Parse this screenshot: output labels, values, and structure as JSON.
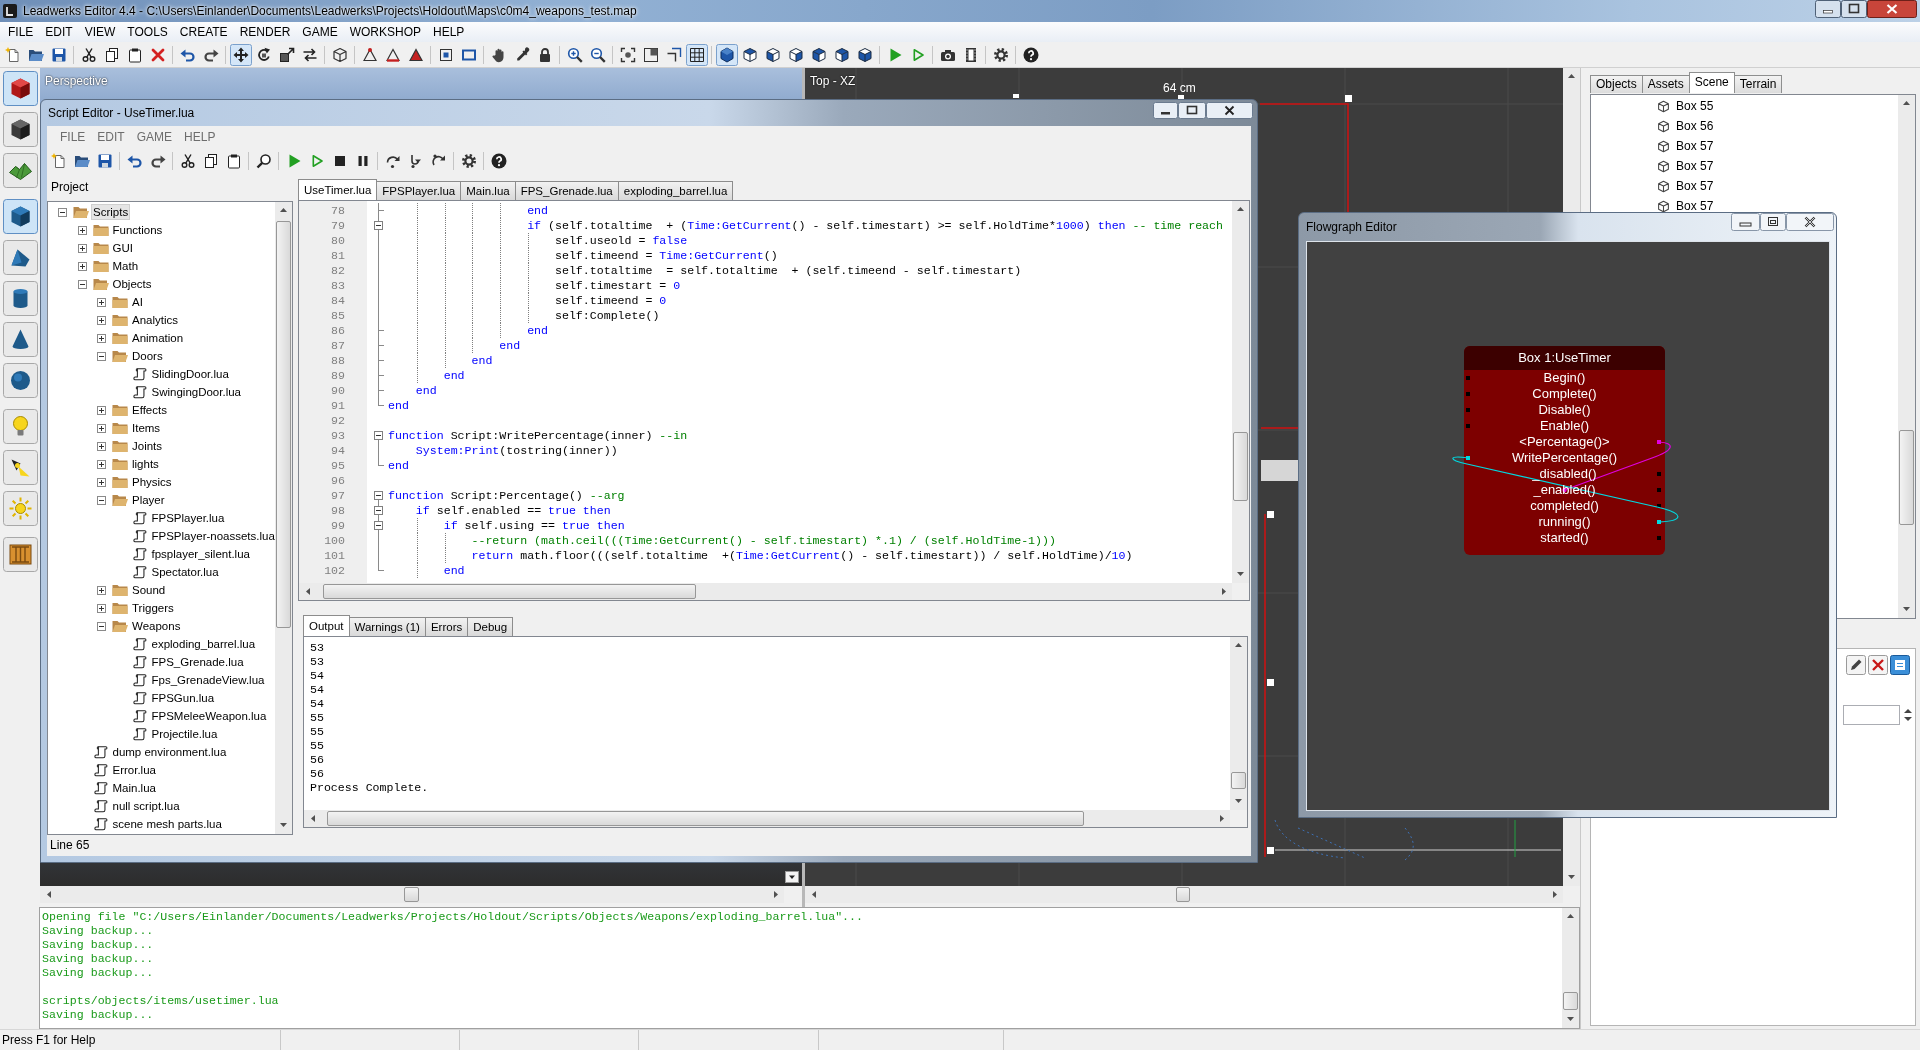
{
  "window": {
    "title": "Leadwerks Editor 4.4 - C:\\Users\\Einlander\\Documents\\Leadwerks\\Projects\\Holdout\\Maps\\c0m4_weapons_test.map"
  },
  "menu": [
    "FILE",
    "EDIT",
    "VIEW",
    "TOOLS",
    "CREATE",
    "RENDER",
    "GAME",
    "WORKSHOP",
    "HELP"
  ],
  "toolbar": [
    [
      {
        "pressed": false
      },
      {
        "pressed": false
      },
      {
        "pressed": false
      }
    ],
    [
      {
        "pressed": false
      },
      {
        "pressed": false
      },
      {
        "pressed": false
      },
      {
        "pressed": false
      }
    ],
    [
      {
        "pressed": false
      },
      {
        "pressed": false
      }
    ],
    [
      {
        "pressed": true
      },
      {
        "pressed": false
      },
      {
        "pressed": false
      },
      {
        "pressed": false
      }
    ],
    [
      {
        "pressed": false
      }
    ],
    [
      {
        "pressed": false
      },
      {
        "pressed": false
      },
      {
        "pressed": false
      }
    ],
    [
      {
        "pressed": false
      },
      {
        "pressed": false
      }
    ],
    [
      {
        "pressed": false
      },
      {
        "pressed": false
      },
      {
        "pressed": false
      }
    ],
    [
      {
        "pressed": false
      },
      {
        "pressed": false
      }
    ],
    [
      {
        "pressed": false
      },
      {
        "pressed": false
      },
      {
        "pressed": false
      },
      {
        "pressed": true
      }
    ],
    [
      {
        "pressed": true
      },
      {
        "pressed": false
      },
      {
        "pressed": false
      },
      {
        "pressed": false
      },
      {
        "pressed": false
      },
      {
        "pressed": false
      },
      {
        "pressed": false
      }
    ],
    [
      {
        "pressed": false
      },
      {
        "pressed": false
      }
    ],
    [
      {
        "pressed": false
      },
      {
        "pressed": false
      }
    ],
    [
      {
        "pressed": false
      }
    ],
    [
      {
        "pressed": false
      }
    ]
  ],
  "tools": [
    [
      {
        "pressed": true
      },
      {
        "pressed": false
      },
      {
        "pressed": false
      }
    ],
    [
      {
        "pressed": true
      },
      {
        "pressed": false
      },
      {
        "pressed": false
      },
      {
        "pressed": false
      },
      {
        "pressed": false
      }
    ],
    [
      {
        "pressed": false
      },
      {
        "pressed": false
      },
      {
        "pressed": false
      }
    ],
    [
      {
        "pressed": false
      }
    ]
  ],
  "viewports": [
    {
      "kind": "render",
      "label": "Perspective"
    },
    {
      "kind": "grid",
      "label": "Top - XZ",
      "scale": "64 cm"
    }
  ],
  "script_editor": {
    "title": "Script Editor - UseTimer.lua",
    "menu": [
      "FILE",
      "EDIT",
      "GAME",
      "HELP"
    ],
    "project": {
      "label": "Project",
      "tree": [
        {
          "label": "Scripts",
          "kind": "folder",
          "expanded": true,
          "selected": true,
          "children": [
            {
              "label": "Functions",
              "kind": "folder",
              "expanded": false,
              "selected": false
            },
            {
              "label": "GUI",
              "kind": "folder",
              "expanded": false,
              "selected": false
            },
            {
              "label": "Math",
              "kind": "folder",
              "expanded": false,
              "selected": false
            },
            {
              "label": "Objects",
              "kind": "folder",
              "expanded": true,
              "selected": false,
              "children": [
                {
                  "label": "AI",
                  "kind": "folder",
                  "expanded": false,
                  "selected": false
                },
                {
                  "label": "Analytics",
                  "kind": "folder",
                  "expanded": false,
                  "selected": false
                },
                {
                  "label": "Animation",
                  "kind": "folder",
                  "expanded": false,
                  "selected": false
                },
                {
                  "label": "Doors",
                  "kind": "folder",
                  "expanded": true,
                  "selected": false,
                  "children": [
                    {
                      "label": "SlidingDoor.lua",
                      "kind": "file",
                      "selected": false
                    },
                    {
                      "label": "SwingingDoor.lua",
                      "kind": "file",
                      "selected": false
                    }
                  ]
                },
                {
                  "label": "Effects",
                  "kind": "folder",
                  "expanded": false,
                  "selected": false
                },
                {
                  "label": "Items",
                  "kind": "folder",
                  "expanded": false,
                  "selected": false
                },
                {
                  "label": "Joints",
                  "kind": "folder",
                  "expanded": false,
                  "selected": false
                },
                {
                  "label": "lights",
                  "kind": "folder",
                  "expanded": false,
                  "selected": false
                },
                {
                  "label": "Physics",
                  "kind": "folder",
                  "expanded": false,
                  "selected": false
                },
                {
                  "label": "Player",
                  "kind": "folder",
                  "expanded": true,
                  "selected": false,
                  "children": [
                    {
                      "label": "FPSPlayer.lua",
                      "kind": "file",
                      "selected": false
                    },
                    {
                      "label": "FPSPlayer-noassets.lua",
                      "kind": "file",
                      "selected": false
                    },
                    {
                      "label": "fpsplayer_silent.lua",
                      "kind": "file",
                      "selected": false
                    },
                    {
                      "label": "Spectator.lua",
                      "kind": "file",
                      "selected": false
                    }
                  ]
                },
                {
                  "label": "Sound",
                  "kind": "folder",
                  "expanded": false,
                  "selected": false
                },
                {
                  "label": "Triggers",
                  "kind": "folder",
                  "expanded": false,
                  "selected": false
                },
                {
                  "label": "Weapons",
                  "kind": "folder",
                  "expanded": true,
                  "selected": false,
                  "children": [
                    {
                      "label": "exploding_barrel.lua",
                      "kind": "file",
                      "selected": false
                    },
                    {
                      "label": "FPS_Grenade.lua",
                      "kind": "file",
                      "selected": false
                    },
                    {
                      "label": "Fps_GrenadeView.lua",
                      "kind": "file",
                      "selected": false
                    },
                    {
                      "label": "FPSGun.lua",
                      "kind": "file",
                      "selected": false
                    },
                    {
                      "label": "FPSMeleeWeapon.lua",
                      "kind": "file",
                      "selected": false
                    },
                    {
                      "label": "Projectile.lua",
                      "kind": "file",
                      "selected": false
                    }
                  ]
                }
              ]
            },
            {
              "label": "dump environment.lua",
              "kind": "file",
              "selected": false
            },
            {
              "label": "Error.lua",
              "kind": "file",
              "selected": false
            },
            {
              "label": "Main.lua",
              "kind": "file",
              "selected": false
            },
            {
              "label": "null script.lua",
              "kind": "file",
              "selected": false
            },
            {
              "label": "scene mesh parts.lua",
              "kind": "file",
              "selected": false
            }
          ]
        }
      ]
    },
    "tabs": [
      {
        "label": "UseTimer.lua",
        "selected": true
      },
      {
        "label": "FPSPlayer.lua",
        "selected": false
      },
      {
        "label": "Main.lua",
        "selected": false
      },
      {
        "label": "FPS_Grenade.lua",
        "selected": false
      },
      {
        "label": "exploding_barrel.lua",
        "selected": false
      }
    ],
    "code": [
      {
        "number": "78",
        "kind": "end",
        "spans": [
          {
            "kind": "keyword",
            "text": "                    end"
          }
        ]
      },
      {
        "number": "79",
        "kind": "start",
        "expanded": true,
        "spans": [
          {
            "kind": "keyword",
            "text": "                    if"
          },
          {
            "kind": "plain",
            "text": " (self.totaltime  + ("
          },
          {
            "kind": "keyword",
            "text": "Time:GetCurrent"
          },
          {
            "kind": "plain",
            "text": "() - self.timestart) >= self.HoldTime*"
          },
          {
            "kind": "keyword",
            "text": "1000"
          },
          {
            "kind": "plain",
            "text": ") "
          },
          {
            "kind": "keyword",
            "text": "then"
          },
          {
            "kind": "comment",
            "text": " -- time reach"
          }
        ]
      },
      {
        "number": "80",
        "kind": "body",
        "spans": [
          {
            "kind": "plain",
            "text": "                        self.useold = "
          },
          {
            "kind": "keyword",
            "text": "false"
          }
        ]
      },
      {
        "number": "81",
        "kind": "body",
        "spans": [
          {
            "kind": "plain",
            "text": "                        self.timeend = "
          },
          {
            "kind": "keyword",
            "text": "Time:GetCurrent"
          },
          {
            "kind": "plain",
            "text": "()"
          }
        ]
      },
      {
        "number": "82",
        "kind": "body",
        "spans": [
          {
            "kind": "plain",
            "text": "                        self.totaltime  = self.totaltime  + (self.timeend - self.timestart)"
          }
        ]
      },
      {
        "number": "83",
        "kind": "body",
        "spans": [
          {
            "kind": "plain",
            "text": "                        self.timestart = "
          },
          {
            "kind": "keyword",
            "text": "0"
          }
        ]
      },
      {
        "number": "84",
        "kind": "body",
        "spans": [
          {
            "kind": "plain",
            "text": "                        self.timeend = "
          },
          {
            "kind": "keyword",
            "text": "0"
          }
        ]
      },
      {
        "number": "85",
        "kind": "body",
        "spans": [
          {
            "kind": "plain",
            "text": "                        self:Complete()"
          }
        ]
      },
      {
        "number": "86",
        "kind": "end",
        "spans": [
          {
            "kind": "keyword",
            "text": "                    end"
          }
        ]
      },
      {
        "number": "87",
        "kind": "end",
        "spans": [
          {
            "kind": "keyword",
            "text": "                end"
          }
        ]
      },
      {
        "number": "88",
        "kind": "end",
        "spans": [
          {
            "kind": "keyword",
            "text": "            end"
          }
        ]
      },
      {
        "number": "89",
        "kind": "end",
        "spans": [
          {
            "kind": "keyword",
            "text": "        end"
          }
        ]
      },
      {
        "number": "90",
        "kind": "end",
        "spans": [
          {
            "kind": "keyword",
            "text": "    end"
          }
        ]
      },
      {
        "number": "91",
        "kind": "end",
        "spans": [
          {
            "kind": "keyword",
            "text": "end"
          }
        ]
      },
      {
        "number": "92",
        "kind": "none"
      },
      {
        "number": "93",
        "kind": "start",
        "expanded": true,
        "spans": [
          {
            "kind": "keyword",
            "text": "function"
          },
          {
            "kind": "plain",
            "text": " Script:WritePercentage(inner) "
          },
          {
            "kind": "comment",
            "text": "--in"
          }
        ]
      },
      {
        "number": "94",
        "kind": "body",
        "spans": [
          {
            "kind": "keyword",
            "text": "    System:Print"
          },
          {
            "kind": "plain",
            "text": "(tostring(inner))"
          }
        ]
      },
      {
        "number": "95",
        "kind": "end",
        "spans": [
          {
            "kind": "keyword",
            "text": "end"
          }
        ]
      },
      {
        "number": "96",
        "kind": "none"
      },
      {
        "number": "97",
        "kind": "start",
        "expanded": true,
        "spans": [
          {
            "kind": "keyword",
            "text": "function"
          },
          {
            "kind": "plain",
            "text": " Script:Percentage() "
          },
          {
            "kind": "comment",
            "text": "--arg"
          }
        ]
      },
      {
        "number": "98",
        "kind": "start",
        "expanded": true,
        "spans": [
          {
            "kind": "keyword",
            "text": "    if"
          },
          {
            "kind": "plain",
            "text": " self.enabled == "
          },
          {
            "kind": "keyword",
            "text": "true"
          },
          {
            "kind": "keyword",
            "text": " then"
          }
        ]
      },
      {
        "number": "99",
        "kind": "start",
        "expanded": true,
        "spans": [
          {
            "kind": "keyword",
            "text": "        if"
          },
          {
            "kind": "plain",
            "text": " self.using == "
          },
          {
            "kind": "keyword",
            "text": "true"
          },
          {
            "kind": "keyword",
            "text": " then"
          }
        ]
      },
      {
        "number": "100",
        "kind": "body",
        "spans": [
          {
            "kind": "comment",
            "text": "            --return (math.ceil(((Time:GetCurrent() - self.timestart) *.1) / (self.HoldTime-1)))"
          }
        ]
      },
      {
        "number": "101",
        "kind": "body",
        "spans": [
          {
            "kind": "keyword",
            "text": "            return"
          },
          {
            "kind": "plain",
            "text": " math.floor(((self.totaltime  +("
          },
          {
            "kind": "keyword",
            "text": "Time:GetCurrent"
          },
          {
            "kind": "plain",
            "text": "() - self.timestart)) / self.HoldTime)/"
          },
          {
            "kind": "keyword",
            "text": "10"
          },
          {
            "kind": "plain",
            "text": ")"
          }
        ]
      },
      {
        "number": "102",
        "kind": "end",
        "spans": [
          {
            "kind": "keyword",
            "text": "        end"
          }
        ]
      }
    ],
    "output_tabs": [
      {
        "label": "Output",
        "selected": true
      },
      {
        "label": "Warnings (1)",
        "selected": false
      },
      {
        "label": "Errors",
        "selected": false
      },
      {
        "label": "Debug",
        "selected": false
      }
    ],
    "output": [
      "53",
      "53",
      "54",
      "54",
      "54",
      "55",
      "55",
      "55",
      "56",
      "56",
      "Process Complete."
    ],
    "status": "Line 65"
  },
  "right_panel": {
    "tabs": [
      {
        "label": "Objects",
        "selected": false
      },
      {
        "label": "Assets",
        "selected": false
      },
      {
        "label": "Scene",
        "selected": true
      },
      {
        "label": "Terrain",
        "selected": false
      }
    ],
    "items": [
      {
        "label": "Box 55",
        "selected": false
      },
      {
        "label": "Box 56",
        "selected": false
      },
      {
        "label": "Box 57",
        "selected": false
      },
      {
        "label": "Box 57",
        "selected": false
      },
      {
        "label": "Box 57",
        "selected": false
      },
      {
        "label": "Box 57",
        "selected": false
      }
    ]
  },
  "flowgraph": {
    "title": "Flowgraph Editor",
    "node": {
      "title": "Box 1:UseTimer",
      "ports": [
        {
          "name": "Begin()",
          "kind": "input"
        },
        {
          "name": "Complete()",
          "kind": "input"
        },
        {
          "name": "Disable()",
          "kind": "input"
        },
        {
          "name": "Enable()",
          "kind": "input"
        },
        {
          "name": "<Percentage()>",
          "kind": "output",
          "color": "#e000e0"
        },
        {
          "name": "WritePercentage()",
          "kind": "input",
          "color": "#00d8e0"
        },
        {
          "name": "_disabled()",
          "kind": "output"
        },
        {
          "name": "_enabled()",
          "kind": "output"
        },
        {
          "name": "completed()",
          "kind": "output"
        },
        {
          "name": "running()",
          "kind": "output",
          "color": "#00d8e0"
        },
        {
          "name": "started()",
          "kind": "output"
        }
      ]
    }
  },
  "console": [
    [
      "Opening file \"C:/Users/Einlander/Documents/Leadwerks/Projects/Holdout/Scripts/Objects/Weapons/exploding_barrel.lua\"...",
      "Saving backup...",
      "Saving backup...",
      "Saving backup...",
      "Saving backup..."
    ],
    [
      "scripts/objects/items/usetimer.lua",
      "Saving backup..."
    ]
  ],
  "status_bar": {
    "text": "Press F1 for Help"
  }
}
